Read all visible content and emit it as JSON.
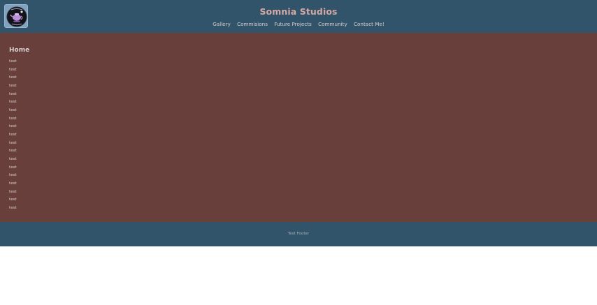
{
  "header": {
    "title": "Somnia Studios",
    "logo_icon": "teapot-moon-logo",
    "logo_bg": "#6f96b6",
    "nav": [
      {
        "label": "Gallery"
      },
      {
        "label": "Commisions"
      },
      {
        "label": "Future Projects"
      },
      {
        "label": "Community"
      },
      {
        "label": "Contact Me!"
      }
    ]
  },
  "main": {
    "heading": "Home",
    "items": [
      "test",
      "test",
      "test",
      "test",
      "test",
      "test",
      "test",
      "test",
      "test",
      "test",
      "test",
      "test",
      "test",
      "test",
      "test",
      "test",
      "test",
      "test",
      "test"
    ]
  },
  "footer": {
    "text": "Test Footer"
  },
  "colors": {
    "header_bg": "#32546a",
    "main_bg": "#683f3a",
    "title_color": "#d4a8a4",
    "page_bg": "#ffffff"
  }
}
